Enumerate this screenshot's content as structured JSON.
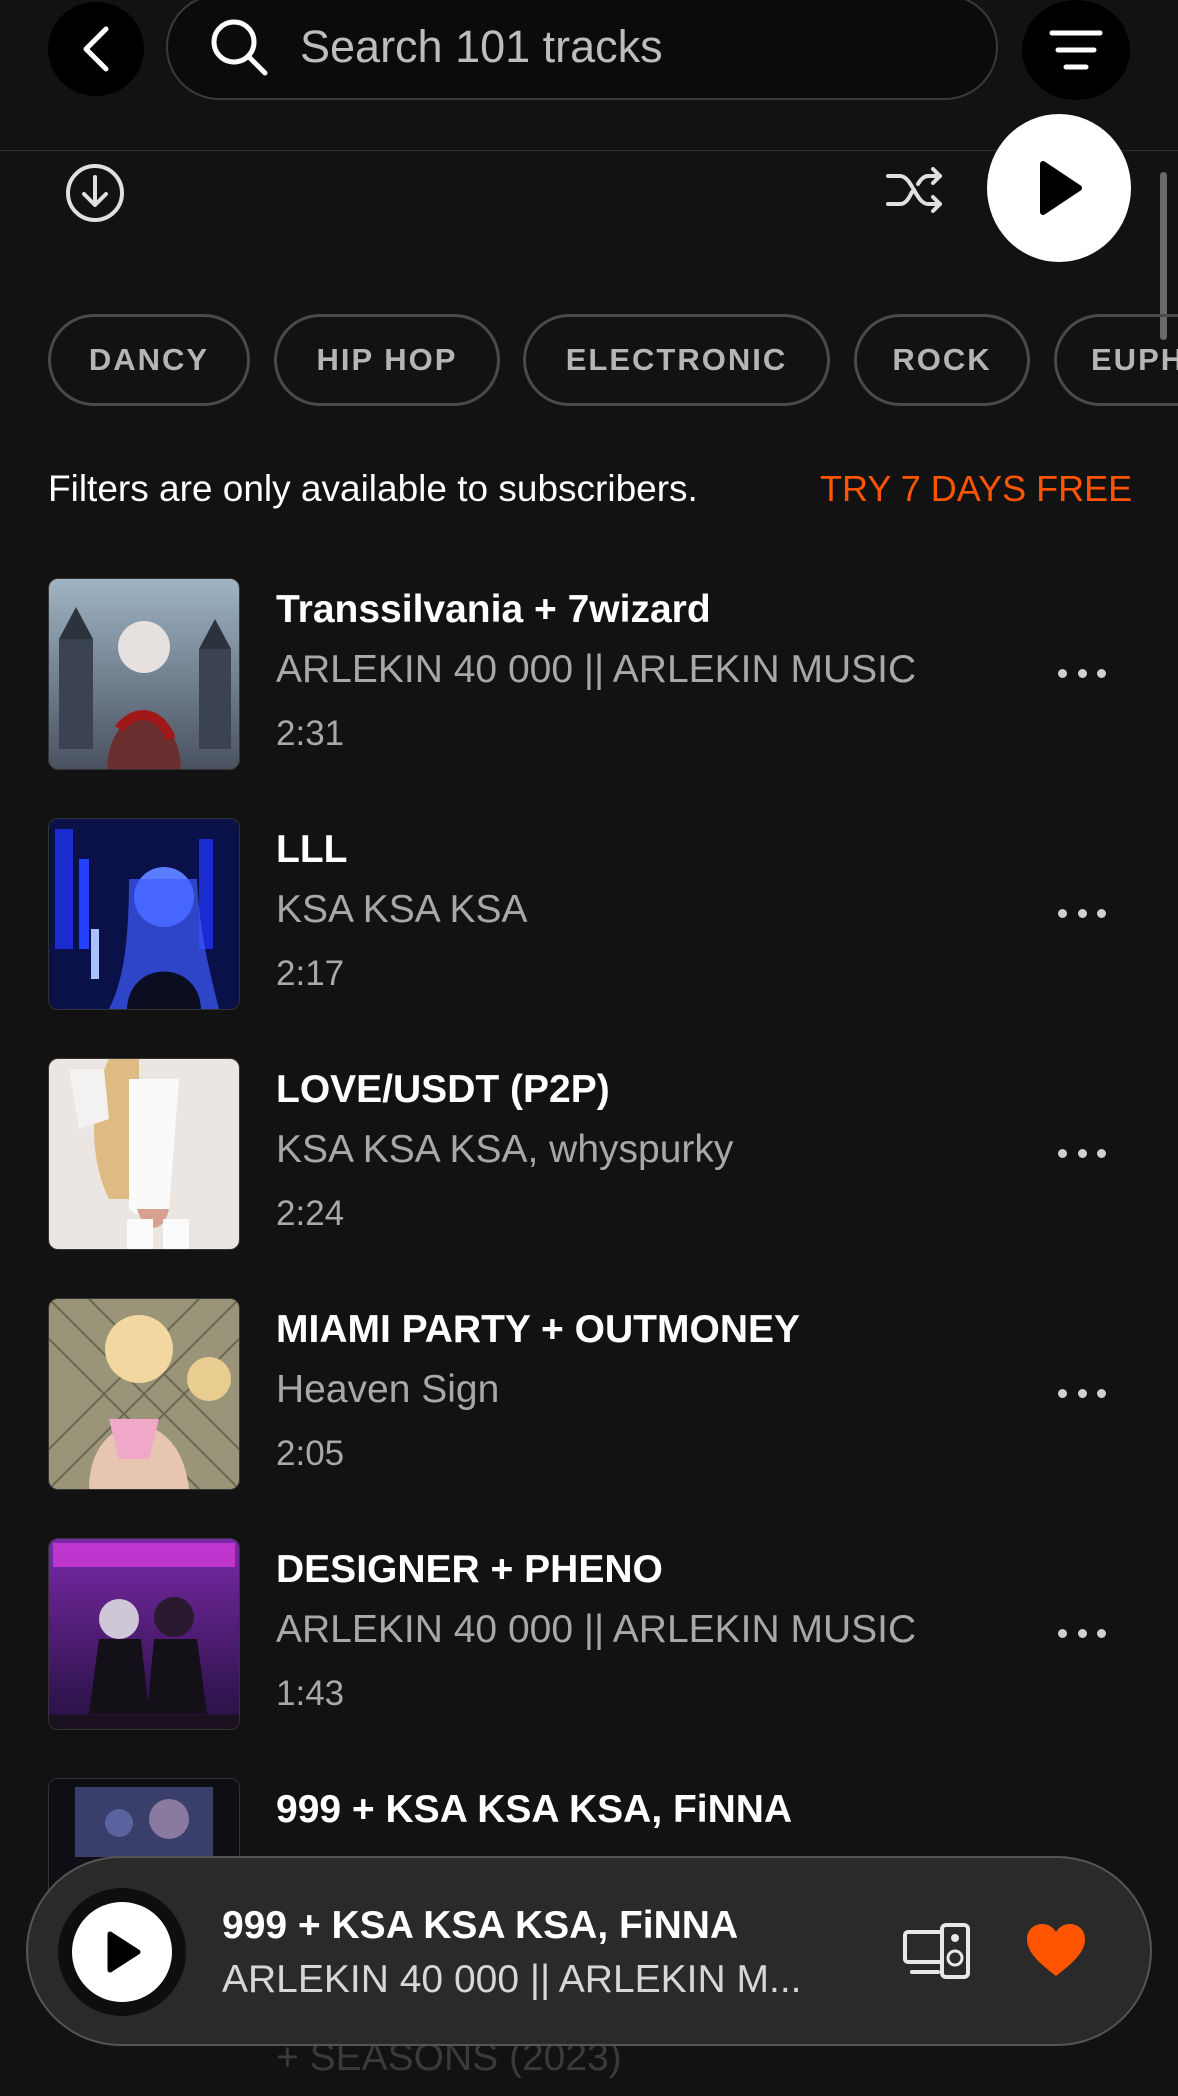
{
  "search": {
    "placeholder": "Search 101 tracks"
  },
  "genres": [
    "DANCY",
    "HIP HOP",
    "ELECTRONIC",
    "ROCK",
    "EUPH"
  ],
  "notice": {
    "text": "Filters are only available to subscribers.",
    "cta": "TRY 7 DAYS FREE"
  },
  "tracks": [
    {
      "title": "Transsilvania + 7wizard",
      "artist": "ARLEKIN 40 000 || ARLEKIN MUSIC",
      "duration": "2:31"
    },
    {
      "title": "LLL",
      "artist": "KSA KSA KSA",
      "duration": "2:17"
    },
    {
      "title": "LOVE/USDT (P2P)",
      "artist": "KSA KSA KSA, whyspurky",
      "duration": "2:24"
    },
    {
      "title": "MIAMI PARTY + OUTMONEY",
      "artist": "Heaven Sign",
      "duration": "2:05"
    },
    {
      "title": "DESIGNER + PHENO",
      "artist": "ARLEKIN 40 000 || ARLEKIN MUSIC",
      "duration": "1:43"
    },
    {
      "title": "999 + KSA KSA KSA, FiNNA",
      "artist": "",
      "duration": ""
    }
  ],
  "now_playing": {
    "title": "999 + KSA KSA KSA, FiNNA",
    "artist": "ARLEKIN 40 000 || ARLEKIN M..."
  },
  "below_text": "+ SEASONS (2023)",
  "colors": {
    "background": "#121212",
    "accent": "#ff5500",
    "text_secondary": "#a8a8a8"
  },
  "icons": [
    "back-icon",
    "search-icon",
    "filter-icon",
    "download-icon",
    "shuffle-icon",
    "play-icon",
    "more-icon",
    "device-icon",
    "heart-icon"
  ]
}
